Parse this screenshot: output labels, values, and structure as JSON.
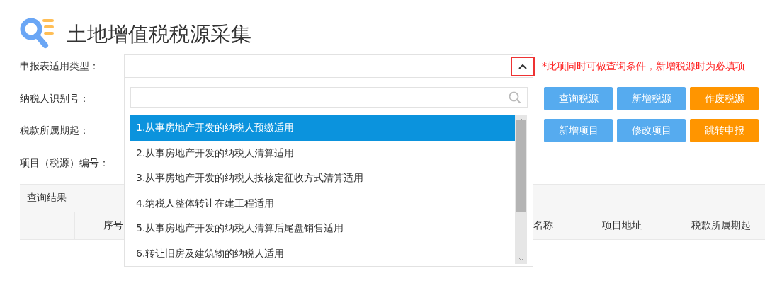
{
  "page": {
    "title": "土地增值税税源采集"
  },
  "form": {
    "labels": [
      "申报表适用类型：",
      "纳税人识别号：",
      "税款所属期起：",
      "项目（税源）编号："
    ]
  },
  "type_select": {
    "expanded": true,
    "hint": "*此项同时可做查询条件，新增税源时为必填项",
    "options": [
      {
        "label": "1.从事房地产开发的纳税人预缴适用",
        "selected": true
      },
      {
        "label": "2.从事房地产开发的纳税人清算适用",
        "selected": false
      },
      {
        "label": "3.从事房地产开发的纳税人按核定征收方式清算适用",
        "selected": false
      },
      {
        "label": "4.纳税人整体转让在建工程适用",
        "selected": false
      },
      {
        "label": "5.从事房地产开发的纳税人清算后尾盘销售适用",
        "selected": false
      },
      {
        "label": "6.转让旧房及建筑物的纳税人适用",
        "selected": false
      }
    ]
  },
  "button_rows": [
    [
      {
        "label": "查询税源",
        "kind": "primary"
      },
      {
        "label": "新增税源",
        "kind": "primary"
      },
      {
        "label": "作废税源",
        "kind": "warning"
      }
    ],
    [
      {
        "label": "新增项目",
        "kind": "primary"
      },
      {
        "label": "修改项目",
        "kind": "primary"
      },
      {
        "label": "跳转申报",
        "kind": "warning"
      }
    ]
  ],
  "results": {
    "title": "查询结果",
    "select_all": {
      "checked": false
    },
    "columns": [
      "序号",
      "名称",
      "项目地址",
      "税款所属期起"
    ]
  }
}
